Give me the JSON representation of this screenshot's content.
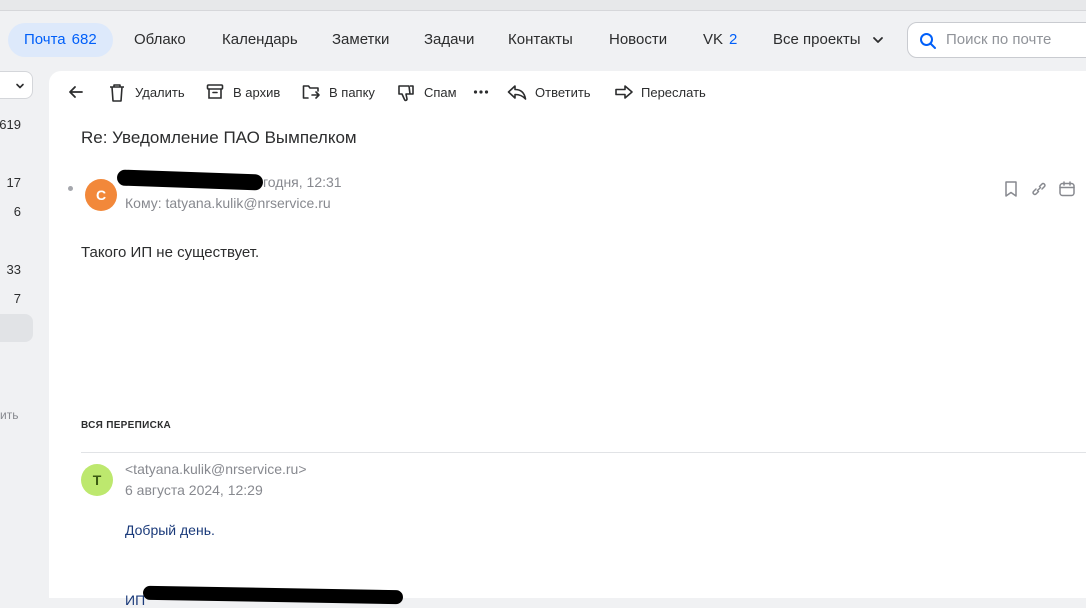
{
  "nav": {
    "mail": {
      "label": "Почта",
      "count": "682"
    },
    "items": [
      "Облако",
      "Календарь",
      "Заметки",
      "Задачи",
      "Контакты",
      "Новости"
    ],
    "vk": {
      "label": "VK",
      "count": "2"
    },
    "all_projects": "Все проекты"
  },
  "search": {
    "placeholder": "Поиск по почте"
  },
  "sidebar": {
    "counts": [
      "619",
      "17",
      "6",
      "33",
      "7"
    ],
    "truncated_text": "ить"
  },
  "toolbar": {
    "delete": "Удалить",
    "archive": "В архив",
    "to_folder": "В папку",
    "spam": "Спам",
    "reply": "Ответить",
    "forward": "Переслать"
  },
  "message": {
    "subject": "Re: Уведомление ПАО Вымпелком",
    "avatar_letter": "С",
    "date": "годня, 12:31",
    "to": "Кому: tatyana.kulik@nrservice.ru",
    "body": "Такого ИП не существует."
  },
  "thread": {
    "title": "ВСЯ ПЕРЕПИСКА",
    "avatar_letter": "Т",
    "sender": "<tatyana.kulik@nrservice.ru>",
    "date": "6 августа 2024, 12:29",
    "greeting": "Добрый день.",
    "truncated_line": "ИП"
  },
  "colors": {
    "accent": "#005ff9",
    "avatar_orange": "#f2883a",
    "avatar_green": "#bde86e"
  }
}
